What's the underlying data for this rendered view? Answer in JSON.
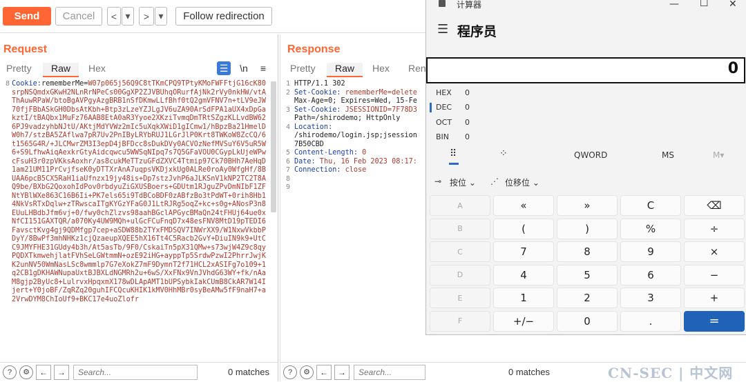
{
  "toolbar": {
    "send": "Send",
    "cancel": "Cancel",
    "back": "<",
    "back_menu": "▾",
    "forward": ">",
    "forward_menu": "▾",
    "follow": "Follow redirection"
  },
  "request": {
    "title": "Request",
    "tabs": [
      "Pretty",
      "Raw",
      "Hex"
    ],
    "icons": {
      "wrap": "☰",
      "newline": "\\n",
      "menu": "≡"
    },
    "line_no": "8",
    "header_name": "Cookie:",
    "cookie_name": "rememberMe",
    "cookie_eq": "=",
    "cookie_value": "W07p065j56Q9C8tTKmCPQ9TPtyKMoFWFFtjG16cK80srpNSQmdxGKwH2NLnRrNPeCs00GgXP2ZJVBUhqORurfAjNk2rVy0nkHW/vtAThAuwRPaW/btoBgAVPgyAzgBRB1nSfDKmwLLfBhf0tQ2gmVFNV7n+tLV9eJW70fjFBbASkGH0DbsAtKbh+Btp3zLzeYZJLgJV6uZA90ArSdFPA1aUX4xDpGakztI/tBAQbx1MuFz76AAB8EtA0aR3Yyoe2XKziTvmqDmTRtSZgzKLLvdBW626PJ9vadzyhbNJtU/AKtjMdYVWz2mIc5uXqkXWiD1gICmw1/hBpzBa21HmelDW0h7/stzBA5ZAflwa7pR7Uv2PnIByLRYbRUJ1LGrJlP0Krt8TWKoW8ZcCQ/6t1565G4R/+JLCMwrZM3I3epD4jBFDcc8sDukDVy0ACVOzNefMVSuY6V5uR5W6+S9LfhwAiqAexkrGtyAidcqwcu5WWSqNIpq7s7Q5GFaVOU0CGypLkUjeWPwcFsuH3r0zpVKksAoxhr/as8cukMeTTzuGFdZXVC4Ttmip97Ck70BHh7AeHqD1am21UM11PrCvjfseK0yDTTXrAnA7uqpsVKDjxkUg0ALRe0roAy0WfgHf/8BUAA6pcB5CX5RaH1iaUfnzx19jy48is+Dp7stzJvhP6aJLKSnV1kNP2TC2T8AQ9be/BXbG2QoxohIdPov0rbdyuZiGXUSBoers+GDUtm1RJguZPvDmNIbF1ZFNtYBlWXe863C16B6Ii+PK7els65i9TdBCoBDF0zABfzBo3tPdWT+0rih8Hb14NkVsRTxDqlw+zTRwscaITgKYGzYFaG0J1LtRJRg5oqZ+kc+s0g+ANosP3n8EUuLHBdbJfm6vj+0/fwy0chZlzvs98aahBGclAPGycBMaQn24tFHUj64ue0xNfCI151GAXTQR/a070Ky4UW9MQh+ulGcFCuFnqD7x48esFNV8MtD19pTEDI6FavsctKvg4gj9QDMfgp7cep+aSDW88b2TYxFMDSQV7INWrXX9/W1NxwVkbbPDyY/8BwPf3mhNHKz1cjQzaeupXQEE5hX16Tt4C5Racb2GvY+DiuIN9k9+UtCC9JMYFHE31GUdy4b3h/At5asTb/9F0/CskaiTn5pX31QMw+s73wjW4Z9c8qyPQDXTkmwehjlatFVhSeLGWtmmN+ozE92iHG+ayppTp5SrdwPzwI2PhrrJwjKK2unNV50WmNasLSc8wmmlp7G7eXokZ7mF9DymnT2f71HCL2xASIFg7o109+1q2CB1gDKHAWNupaUxtBJBXLdNGMRh2u+6wS/XxFNx9VnJVhdG63WY+fk/nAaM8gjp2ByUc8+LulrvxHpqxmX178wDLApAMT1bUPSybkIakCUmB8CkAR7W14Ijert+Y0joBF/ZqRZq20guhIFCQcuKHIK1kMV0HhMBr0syBeAMw5fF9naH7+a2VrwDYM8ChIoUf9+BKC17e4uoZlofr"
  },
  "response": {
    "title": "Response",
    "tabs": [
      "Pretty",
      "Raw",
      "Hex",
      "Rend"
    ],
    "lines": [
      {
        "n": "1",
        "text": "HTTP/1.1 302"
      },
      {
        "n": "2",
        "name": "Set-Cookie:",
        "text": " rememberMe=delete"
      },
      {
        "n": "",
        "text": "Max-Age=0; Expires=Wed, 15-Fe"
      },
      {
        "n": "3",
        "name": "Set-Cookie:",
        "text": " JSESSIONID=7F78D3"
      },
      {
        "n": "",
        "text": "Path=/shirodemo; HttpOnly"
      },
      {
        "n": "4",
        "name": "Location:",
        "text": ""
      },
      {
        "n": "",
        "text": "/shirodemo/login.jsp;jsession"
      },
      {
        "n": "",
        "text": "7B50CBD"
      },
      {
        "n": "5",
        "name": "Content-Length:",
        "text": " 0"
      },
      {
        "n": "6",
        "name": "Date:",
        "text": " Thu, 16 Feb 2023 08:17:"
      },
      {
        "n": "7",
        "name": "Connection:",
        "text": " close"
      },
      {
        "n": "8",
        "text": ""
      },
      {
        "n": "9",
        "text": ""
      }
    ]
  },
  "footer": {
    "search_placeholder": "Search...",
    "matches": "0 matches"
  },
  "calculator": {
    "app_title": "计算器",
    "mode": "程序员",
    "display": "0",
    "radix": [
      {
        "label": "HEX",
        "value": "0"
      },
      {
        "label": "DEC",
        "value": "0"
      },
      {
        "label": "OCT",
        "value": "0"
      },
      {
        "label": "BIN",
        "value": "0"
      }
    ],
    "word_size": "QWORD",
    "ms": "MS",
    "mplus": "M▾",
    "bitwise": "按位",
    "bitshift": "位移位",
    "keys": [
      "A",
      "«",
      "»",
      "C",
      "⌫",
      "B",
      "(",
      ")",
      "%",
      "÷",
      "C",
      "7",
      "8",
      "9",
      "×",
      "D",
      "4",
      "5",
      "6",
      "−",
      "E",
      "1",
      "2",
      "3",
      "+",
      "F",
      "+/−",
      "0",
      ".",
      "="
    ]
  },
  "watermark": "CN-SEC | 中文网"
}
